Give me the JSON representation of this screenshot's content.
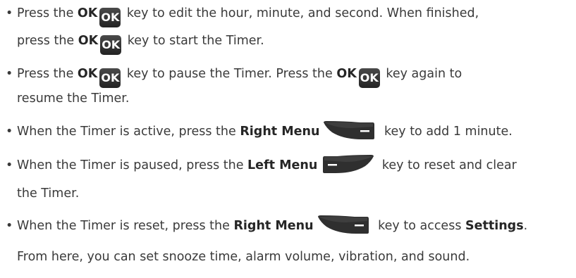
{
  "ok_key_label": "OK",
  "colors": {
    "text": "#3a3a3a",
    "key_bg": "#2e2e2e",
    "key_text": "#ffffff"
  },
  "bullets": [
    {
      "l1a": "Press the ",
      "l1b": "OK",
      "l1c": " key to edit the hour, minute, and second. When finished,",
      "l2a": "press the ",
      "l2b": "OK",
      "l2c": " key to start the Timer."
    },
    {
      "l1a": "Press the ",
      "l1b": "OK",
      "l1c": " key to pause the Timer. Press the ",
      "l1d": "OK",
      "l1e": " key again to",
      "l2": "resume the Timer."
    },
    {
      "l1a": "When the Timer is active, press the ",
      "l1b": "Right Menu",
      "l1c": " key to add 1 minute."
    },
    {
      "l1a": "When the Timer is paused, press the ",
      "l1b": "Left Menu",
      "l1c": " key to reset and clear",
      "l2": "the Timer."
    },
    {
      "l1a": "When the Timer is reset, press the ",
      "l1b": "Right Menu",
      "l1c": " key to access ",
      "l1d": "Settings",
      "l1e": ".",
      "l2": "From here, you can set snooze time, alarm volume, vibration, and sound."
    }
  ]
}
